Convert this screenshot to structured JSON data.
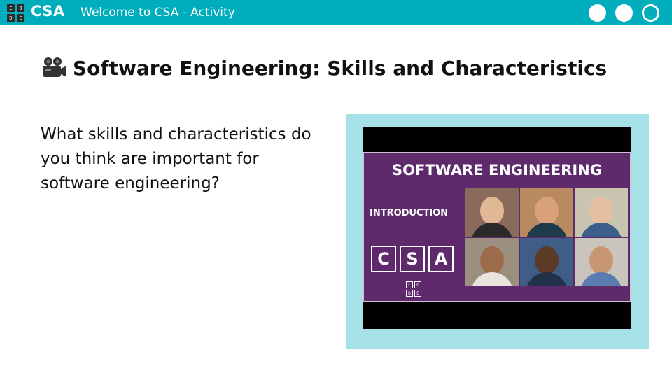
{
  "header": {
    "logo_letters": [
      "C",
      "O",
      "D",
      "E"
    ],
    "brand": "CSA",
    "title": "Welcome to CSA - Activity",
    "controls": [
      "circle",
      "circle",
      "ring"
    ]
  },
  "slide": {
    "title": "Software Engineering: Skills and Characteristics",
    "title_icon": "video-camera-icon",
    "prompt": "What skills and characteristics do you think are important for software engineering?"
  },
  "video": {
    "heading": "SOFTWARE ENGINEERING",
    "subheading": "INTRODUCTION",
    "badge_letters": [
      "C",
      "S",
      "A"
    ],
    "logo_letters": [
      "C",
      "O",
      "D",
      "E"
    ],
    "people_count": 6
  },
  "colors": {
    "header_bg": "#00adbc",
    "video_frame_bg": "#a6e1e8",
    "thumbnail_bg": "#5e2a6b"
  }
}
